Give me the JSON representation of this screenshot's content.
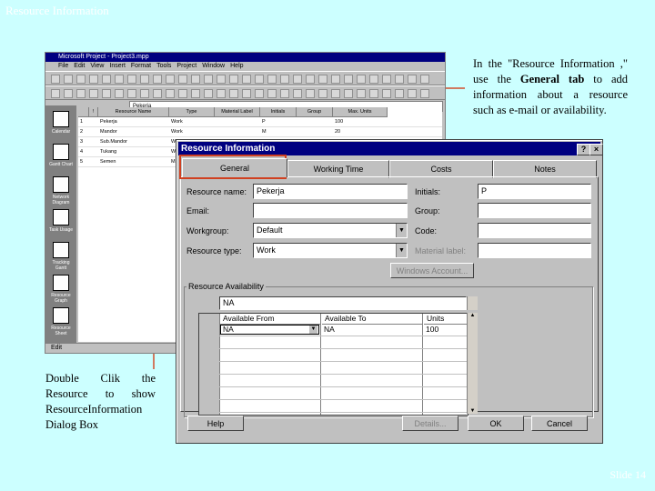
{
  "slide": {
    "title": "Resource Information",
    "number": "Slide 14",
    "callout_right": "In the \"Resource Information ,\" use the General tab to add information about a resource such as e-mail or availability.",
    "callout_right_bold": "General tab",
    "callout_left": "Double Clik the Resource to show ResourceInformation Dialog Box"
  },
  "project_window": {
    "title": "Microsoft Project - Project3.mpp",
    "menu": [
      "File",
      "Edit",
      "View",
      "Insert",
      "Format",
      "Tools",
      "Project",
      "Window",
      "Help"
    ],
    "entry_value": "Pekerja",
    "columns": [
      "",
      "!",
      "Resource Name",
      "Type",
      "Material Label",
      "Initials",
      "Group",
      "Max. Units"
    ],
    "rows": [
      {
        "id": "1",
        "name": "Pekerja",
        "type": "Work",
        "initials": "P",
        "units": "100"
      },
      {
        "id": "2",
        "name": "Mandor",
        "type": "Work",
        "initials": "M",
        "units": "20"
      },
      {
        "id": "3",
        "name": "Sub.Mandor",
        "type": "Work",
        "initials": "",
        "units": ""
      },
      {
        "id": "4",
        "name": "Tukang",
        "type": "Work",
        "initials": "",
        "units": ""
      },
      {
        "id": "5",
        "name": "Semen",
        "type": "Material",
        "initials": "",
        "units": ""
      }
    ],
    "views": [
      "Calendar",
      "Gantt Chart",
      "Network Diagram",
      "Task Usage",
      "Tracking Gantt",
      "Resource Graph",
      "Resource Sheet"
    ],
    "status": "Edit"
  },
  "dialog": {
    "title": "Resource Information",
    "help_btn": "?",
    "close_btn": "×",
    "tabs": [
      "General",
      "Working Time",
      "Costs",
      "Notes"
    ],
    "labels": {
      "resource_name": "Resource name:",
      "initials": "Initials:",
      "email": "Email:",
      "group": "Group:",
      "workgroup": "Workgroup:",
      "code": "Code:",
      "resource_type": "Resource type:",
      "material_label": "Material label:",
      "availability": "Resource Availability"
    },
    "values": {
      "resource_name": "Pekerja",
      "initials": "P",
      "email": "",
      "group": "",
      "workgroup": "Default",
      "code": "",
      "resource_type": "Work",
      "material_label": ""
    },
    "windows_account_btn": "Windows Account...",
    "availability": {
      "edit_value": "NA",
      "columns": [
        "Available From",
        "Available To",
        "Units"
      ],
      "rows": [
        {
          "from": "NA",
          "to": "NA",
          "units": "100"
        }
      ]
    },
    "buttons": {
      "help": "Help",
      "details": "Details...",
      "ok": "OK",
      "cancel": "Cancel"
    }
  },
  "colors": {
    "slide_bg": "#ccffff",
    "titlebar": "#000080",
    "highlight": "#d04020"
  }
}
